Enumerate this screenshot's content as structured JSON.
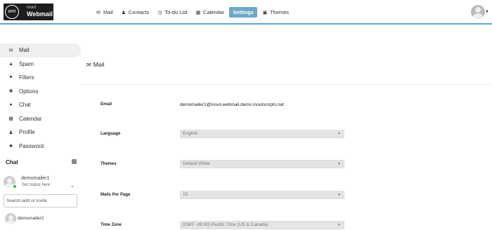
{
  "header": {
    "logo_small": "inout",
    "logo_big": "Webmail",
    "logo_badge": "wm",
    "nav": [
      {
        "label": "Mail",
        "icon": "envelope-icon",
        "glyph": "✉",
        "active": false
      },
      {
        "label": "Contacts",
        "icon": "user-icon",
        "glyph": "♟",
        "active": false
      },
      {
        "label": "To-do List",
        "icon": "clock-icon",
        "glyph": "◷",
        "active": false
      },
      {
        "label": "Calendar",
        "icon": "calendar-icon",
        "glyph": "▦",
        "active": false
      },
      {
        "label": "Settings",
        "icon": "",
        "glyph": "",
        "active": true
      },
      {
        "label": "Themes",
        "icon": "picture-icon",
        "glyph": "▣",
        "active": false
      }
    ]
  },
  "sidebar": {
    "items": [
      {
        "label": "Mail",
        "icon": "envelope-icon",
        "glyph": "✉",
        "active": true
      },
      {
        "label": "Spam",
        "icon": "warning-icon",
        "glyph": "▲",
        "active": false
      },
      {
        "label": "Filters",
        "icon": "filter-icon",
        "glyph": "▼",
        "active": false
      },
      {
        "label": "Options",
        "icon": "gear-icon",
        "glyph": "✱",
        "active": false
      },
      {
        "label": "Chat",
        "icon": "chat-icon",
        "glyph": "●",
        "active": false
      },
      {
        "label": "Calendar",
        "icon": "calendar-icon",
        "glyph": "▦",
        "active": false
      },
      {
        "label": "Profile",
        "icon": "user-icon",
        "glyph": "♟",
        "active": false
      },
      {
        "label": "Password",
        "icon": "lock-icon",
        "glyph": "■",
        "active": false
      }
    ]
  },
  "chat": {
    "title": "Chat",
    "self_name": "demomailer1",
    "self_status": "Set status here",
    "search_placeholder": "Search,add or invite",
    "contacts": [
      {
        "name": "demomailer2"
      }
    ]
  },
  "main": {
    "heading": "Mail",
    "fields": [
      {
        "label": "Email",
        "value": "demomailer1@inout-webmail.demo.inoutscripts.net",
        "type": "text"
      },
      {
        "label": "Language",
        "value": "English",
        "type": "select"
      },
      {
        "label": "Themes",
        "value": "Default White",
        "type": "select"
      },
      {
        "label": "Mails Per Page",
        "value": "15",
        "type": "select"
      },
      {
        "label": "Time Zone",
        "value": "(GMT -08:00) Pacific Time (US & Canada)",
        "type": "select"
      }
    ]
  },
  "colors": {
    "accent": "#5aa8d6",
    "active_tab": "#6fa8c2",
    "online": "#3ab54a"
  }
}
